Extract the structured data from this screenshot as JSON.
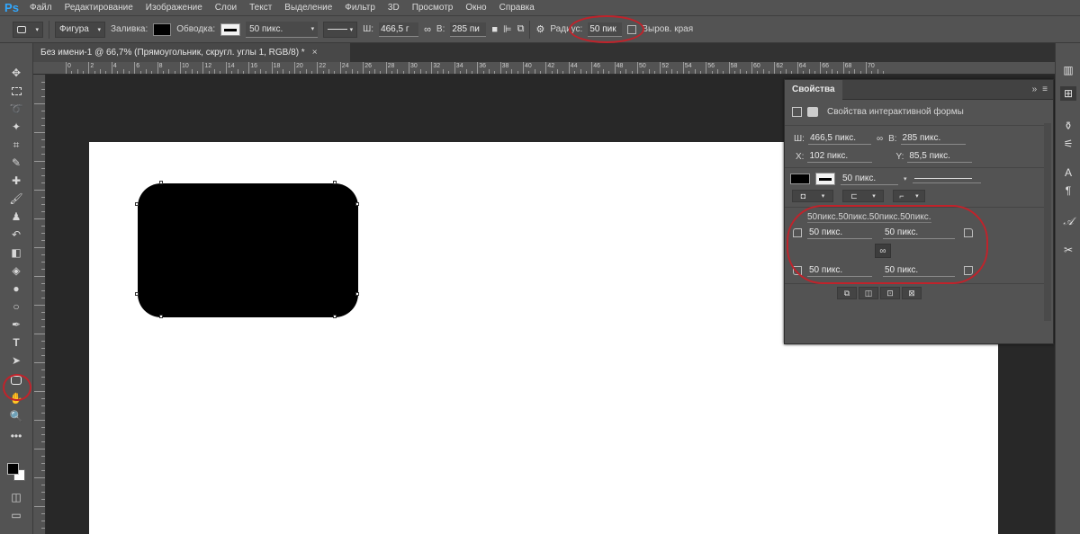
{
  "app": {
    "logo": "Ps"
  },
  "menu": [
    "Файл",
    "Редактирование",
    "Изображение",
    "Слои",
    "Текст",
    "Выделение",
    "Фильтр",
    "3D",
    "Просмотр",
    "Окно",
    "Справка"
  ],
  "options": {
    "shape_mode": "Фигура",
    "fill_label": "Заливка:",
    "stroke_label": "Обводка:",
    "stroke_width": "50 пикс.",
    "w_label": "Ш:",
    "w_value": "466,5 г",
    "h_label": "В:",
    "h_value": "285 пи",
    "radius_label": "Радиус:",
    "radius_value": "50 пик",
    "align_edges_label": "Выров. края"
  },
  "document_tab": {
    "title": "Без имени-1 @ 66,7% (Прямоугольник, скругл. углы 1, RGB/8) *",
    "close": "×"
  },
  "ruler": {
    "h_labels": [
      "0",
      "2",
      "4",
      "6",
      "8",
      "10",
      "12",
      "14",
      "16",
      "18",
      "20",
      "22",
      "24",
      "26",
      "28",
      "30",
      "32",
      "34",
      "36",
      "38",
      "40",
      "42",
      "44",
      "46",
      "48",
      "50",
      "52",
      "54",
      "56",
      "58",
      "60",
      "62",
      "64",
      "66",
      "68",
      "70"
    ]
  },
  "properties": {
    "tab_title": "Свойства",
    "menu_glyph": "»",
    "section_title": "Свойства интерактивной формы",
    "w_label": "Ш:",
    "w_value": "466,5 пикс.",
    "h_label": "В:",
    "h_value": "285 пикс.",
    "x_label": "X:",
    "x_value": "102 пикс.",
    "y_label": "Y:",
    "y_value": "85,5 пикс.",
    "stroke_width": "50 пикс.",
    "corners_summary": "50пикс.50пикс.50пикс.50пикс.",
    "corner_tl": "50 пикс.",
    "corner_tr": "50 пикс.",
    "corner_bl": "50 пикс.",
    "corner_br": "50 пикс."
  },
  "colors": {
    "fill": "#000000",
    "annotation": "#c0232b"
  }
}
